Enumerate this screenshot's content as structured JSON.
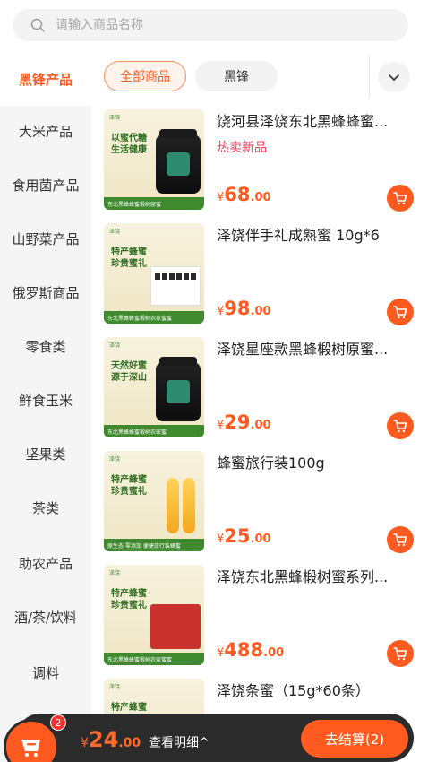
{
  "search": {
    "placeholder": "请输入商品名称"
  },
  "sidebar": {
    "items": [
      {
        "label": "黑锋产品"
      },
      {
        "label": "大米产品"
      },
      {
        "label": "食用菌产品"
      },
      {
        "label": "山野菜产品"
      },
      {
        "label": "俄罗斯商品"
      },
      {
        "label": "零食类"
      },
      {
        "label": "鲜食玉米"
      },
      {
        "label": "坚果类"
      },
      {
        "label": "茶类"
      },
      {
        "label": "助农产品"
      },
      {
        "label": "酒/茶/饮料"
      },
      {
        "label": "调料"
      }
    ]
  },
  "filters": {
    "all": "全部商品",
    "black": "黑锋"
  },
  "products": [
    {
      "title": "饶河县泽饶东北黑蜂蜂蜜...",
      "badge": "热卖新品",
      "currency": "¥",
      "price_int": "68",
      "price_dec": ".00",
      "thumb_tag": "泽饶",
      "thumb_heading": "以蜜代糖\n生活健康",
      "thumb_band": "东北黑蜂蜂蜜椴树原蜜"
    },
    {
      "title": "泽饶伴手礼成熟蜜 10g*6",
      "badge": "",
      "currency": "¥",
      "price_int": "98",
      "price_dec": ".00",
      "thumb_tag": "泽饶",
      "thumb_heading": "特产蜂蜜\n珍贵蜜礼",
      "thumb_band": "东北黑蜂蜂蜜椴树农家蜜蜜"
    },
    {
      "title": "泽饶星座款黑蜂椴树原蜜...",
      "badge": "",
      "currency": "¥",
      "price_int": "29",
      "price_dec": ".00",
      "thumb_tag": "泽饶",
      "thumb_heading": "天然好蜜\n源于深山",
      "thumb_band": "东北黑蜂蜂蜜椴树农家蜜"
    },
    {
      "title": "蜂蜜旅行装100g",
      "badge": "",
      "currency": "¥",
      "price_int": "25",
      "price_dec": ".00",
      "thumb_tag": "泽饶",
      "thumb_heading": "特产蜂蜜\n珍贵蜜礼",
      "thumb_band": "原生态 零添加 便捷旅行装蜂蜜"
    },
    {
      "title": "泽饶东北黑蜂椴树蜜系列...",
      "badge": "",
      "currency": "¥",
      "price_int": "488",
      "price_dec": ".00",
      "thumb_tag": "泽饶",
      "thumb_heading": "特产蜂蜜\n珍贵蜜礼",
      "thumb_band": "东北黑蜂蜂蜜椴树农家蜜蜜"
    },
    {
      "title": "泽饶条蜜（15g*60条）",
      "badge": "",
      "currency": "¥",
      "price_int": "",
      "price_dec": "",
      "thumb_tag": "泽饶",
      "thumb_heading": "特产蜂蜜\n珍贵蜜礼",
      "thumb_band": ""
    }
  ],
  "cart": {
    "badge_count": "2",
    "currency": "¥",
    "total_int": "24",
    "total_dec": ".00",
    "detail_label": "查看明细^",
    "checkout_label": "去结算(2)"
  },
  "colors": {
    "accent": "#ff5a1f",
    "badge": "#ff3d5a",
    "bar": "#2b2b2b",
    "sidebar_bg": "#f5f5f5"
  }
}
